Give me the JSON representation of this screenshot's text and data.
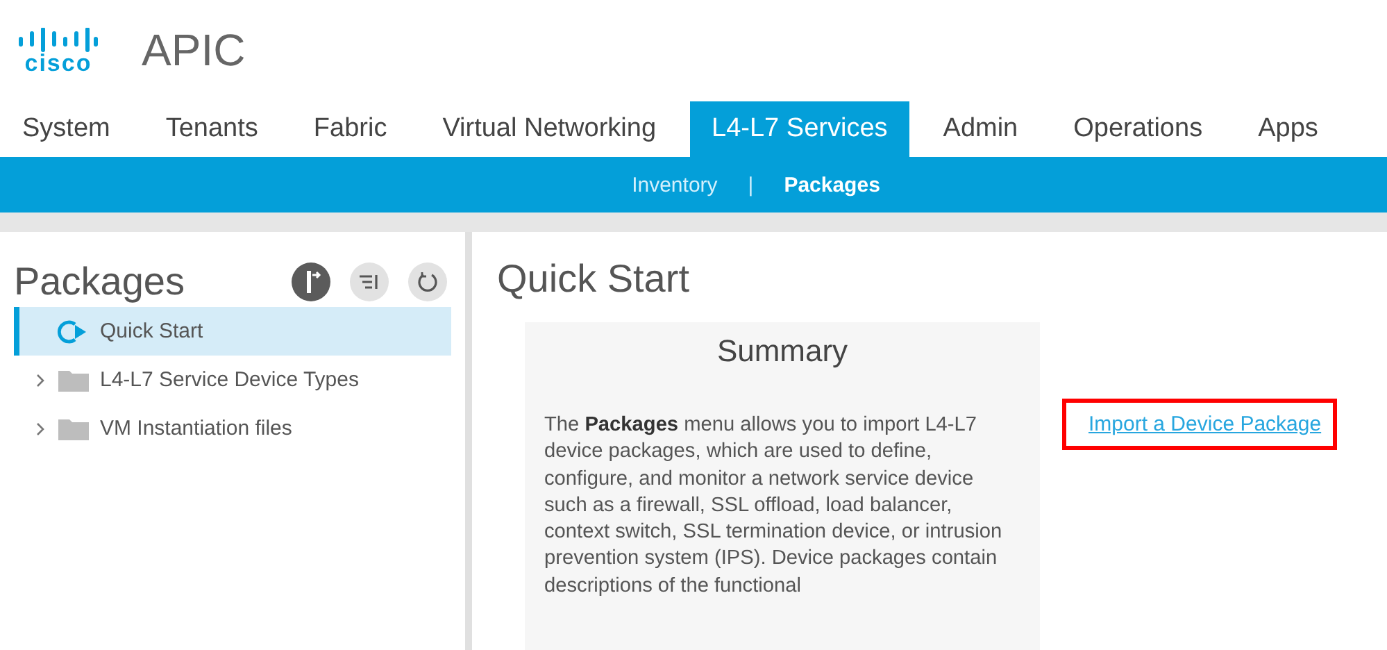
{
  "header": {
    "logo_text": "cisco",
    "app_title": "APIC"
  },
  "tabs": [
    {
      "label": "System",
      "selected": false
    },
    {
      "label": "Tenants",
      "selected": false
    },
    {
      "label": "Fabric",
      "selected": false
    },
    {
      "label": "Virtual Networking",
      "selected": false
    },
    {
      "label": "L4-L7 Services",
      "selected": true
    },
    {
      "label": "Admin",
      "selected": false
    },
    {
      "label": "Operations",
      "selected": false
    },
    {
      "label": "Apps",
      "selected": false
    }
  ],
  "subtabs": [
    {
      "label": "Inventory",
      "selected": false
    },
    {
      "label": "Packages",
      "selected": true
    }
  ],
  "subtab_separator": "|",
  "sidebar": {
    "title": "Packages",
    "tools": [
      {
        "kind": "dark"
      },
      {
        "kind": "sort"
      },
      {
        "kind": "refresh"
      }
    ],
    "items": [
      {
        "label": "Quick Start",
        "kind": "start",
        "selected": true
      },
      {
        "label": "L4-L7 Service Device Types",
        "kind": "folder",
        "selected": false,
        "expanded": false
      },
      {
        "label": "VM Instantiation files",
        "kind": "folder",
        "selected": false,
        "expanded": false
      }
    ]
  },
  "main": {
    "title": "Quick Start",
    "summary": {
      "title": "Summary",
      "text": "The **Packages** menu allows you to import L4-L7 device packages, which are used to define, configure, and monitor a network service device such as a firewall, SSL offload, load balancer, context switch, SSL termination device, or intrusion prevention system (IPS). Device packages contain descriptions of the functional"
    },
    "link": {
      "label": "Import a Device Package",
      "highlighted": true
    }
  }
}
